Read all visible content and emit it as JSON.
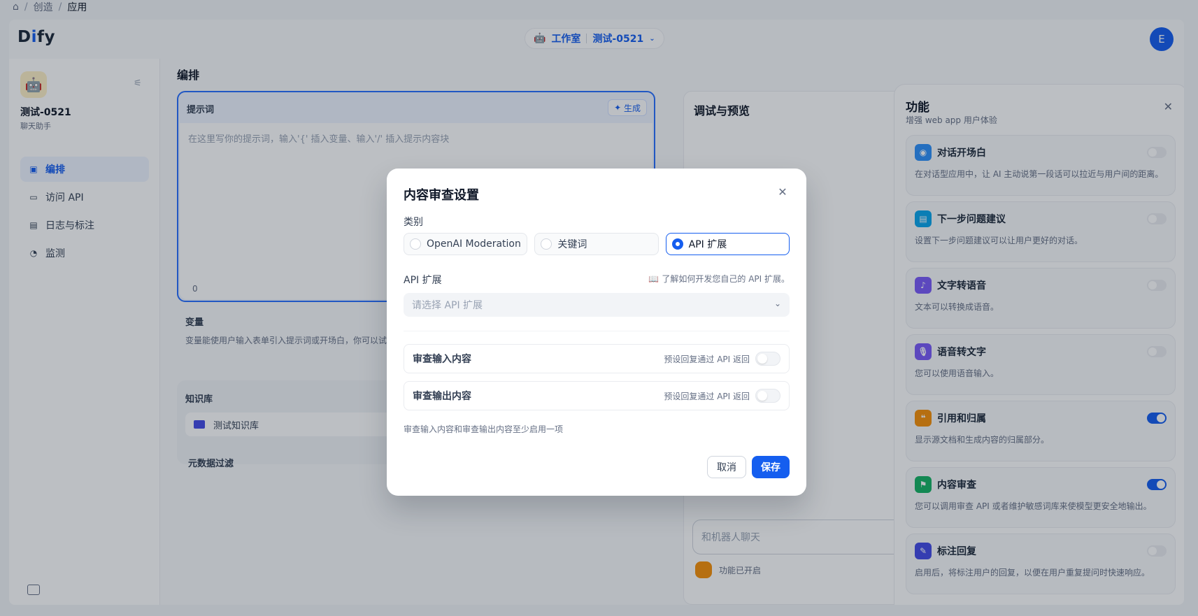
{
  "breadcrumb": {
    "items": [
      "创造",
      "应用"
    ]
  },
  "topbar": {
    "logo": "Dify",
    "studio_label": "工作室",
    "app_switch": "测试-0521",
    "user_initial": "E"
  },
  "sidebar": {
    "app_name": "测试-0521",
    "app_type": "聊天助手",
    "items": [
      {
        "label": "编排",
        "icon": "layout-icon",
        "active": true
      },
      {
        "label": "访问 API",
        "icon": "terminal-icon"
      },
      {
        "label": "日志与标注",
        "icon": "log-icon"
      },
      {
        "label": "监测",
        "icon": "monitor-icon"
      }
    ]
  },
  "main": {
    "title": "编排",
    "prompt": {
      "label": "提示词",
      "generate": "生成",
      "placeholder": "在这里写你的提示词，输入'{' 插入变量、输入'/' 插入提示内容块",
      "count": "0"
    },
    "variables": {
      "title": "变量",
      "desc": "变量能使用户输入表单引入提示词或开场白，你可以试"
    },
    "knowledge": {
      "title": "知识库",
      "item": "测试知识库"
    },
    "metadata": {
      "title": "元数据过滤"
    },
    "debug": {
      "title": "调试与预览",
      "chat_placeholder": "和机器人聊天",
      "features_on": "功能已开启"
    }
  },
  "features": {
    "title": "功能",
    "subtitle": "增强 web app 用户体验",
    "items": [
      {
        "name": "对话开场白",
        "desc": "在对话型应用中，让 AI 主动说第一段话可以拉近与用户间的距离。",
        "on": false,
        "color": "#2e90fa"
      },
      {
        "name": "下一步问题建议",
        "desc": "设置下一步问题建议可以让用户更好的对话。",
        "on": false,
        "color": "#0ba5ec"
      },
      {
        "name": "文字转语音",
        "desc": "文本可以转换成语音。",
        "on": false,
        "color": "#7a5af8"
      },
      {
        "name": "语音转文字",
        "desc": "您可以使用语音输入。",
        "on": false,
        "color": "#7a5af8"
      },
      {
        "name": "引用和归属",
        "desc": "显示源文档和生成内容的归属部分。",
        "on": true,
        "color": "#f79009"
      },
      {
        "name": "内容审查",
        "desc": "您可以调用审查 API 或者维护敏感词库来使模型更安全地输出。",
        "on": true,
        "color": "#16b364"
      },
      {
        "name": "标注回复",
        "desc": "启用后，将标注用户的回复，以便在用户重复提问时快速响应。",
        "on": false,
        "color": "#444ce7"
      }
    ]
  },
  "modal": {
    "title": "内容审查设置",
    "category_label": "类别",
    "types": [
      {
        "label": "OpenAI Moderation",
        "selected": false
      },
      {
        "label": "关键词",
        "selected": false
      },
      {
        "label": "API 扩展",
        "selected": true
      }
    ],
    "api_label": "API 扩展",
    "api_link": "了解如何开发您自己的 API 扩展。",
    "select_placeholder": "请选择 API 扩展",
    "input_row": {
      "label": "审查输入内容",
      "hint": "预设回复通过 API 返回",
      "on": false
    },
    "output_row": {
      "label": "审查输出内容",
      "hint": "预设回复通过 API 返回",
      "on": false
    },
    "note": "审查输入内容和审查输出内容至少启用一项",
    "cancel": "取消",
    "save": "保存"
  }
}
